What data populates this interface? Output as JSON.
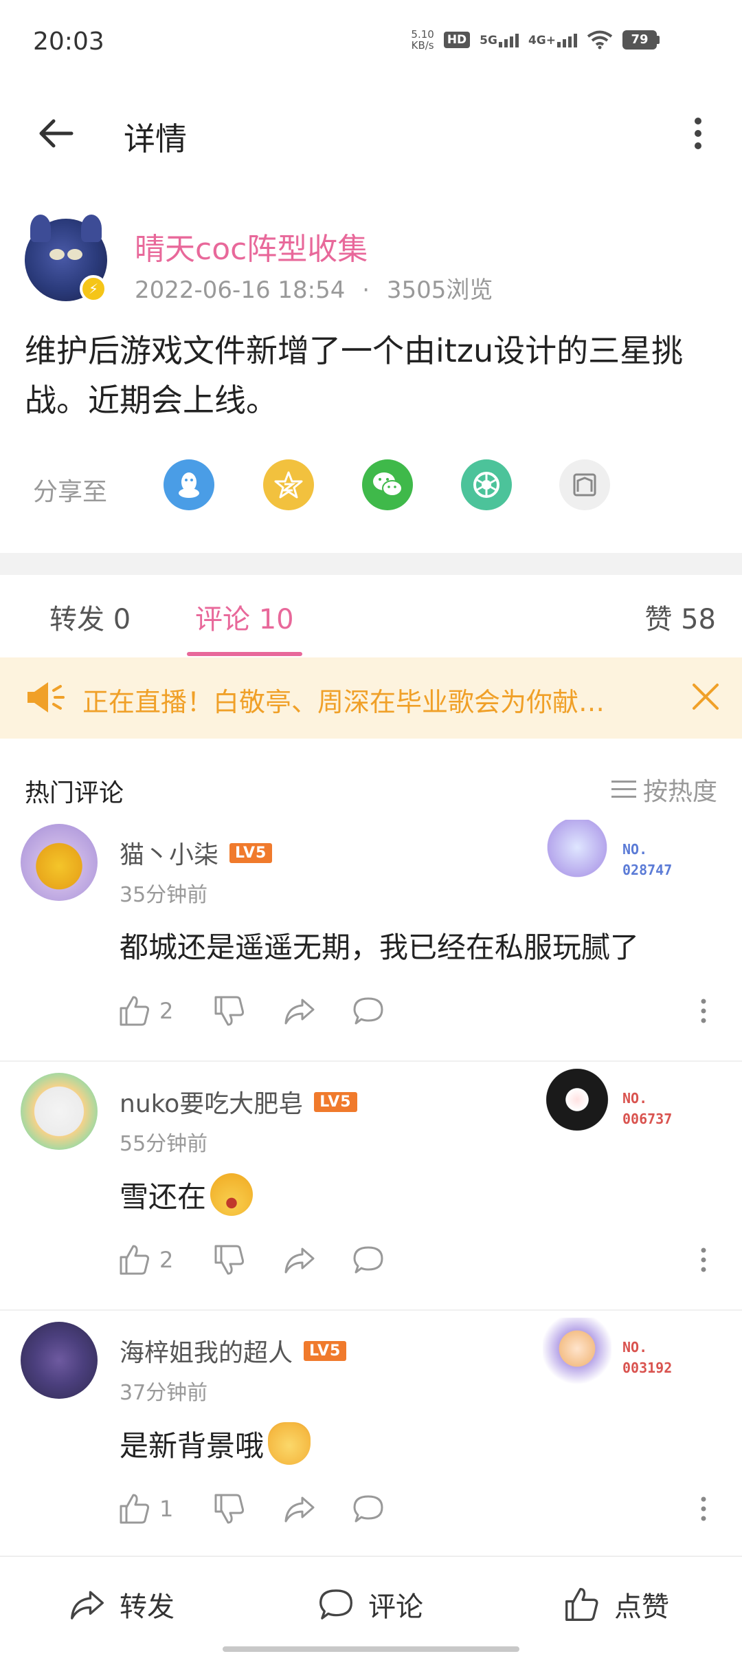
{
  "status_bar": {
    "time": "20:03",
    "net_speed_value": "5.10",
    "net_speed_unit": "KB/s",
    "hd_label": "HD",
    "signal_1": "5G",
    "signal_2": "4G+",
    "battery": "79"
  },
  "header": {
    "title": "详情"
  },
  "post": {
    "author": "晴天coc阵型收集",
    "date": "2022-06-16 18:54",
    "views": "3505浏览",
    "text": "维护后游戏文件新增了一个由itzu设计的三星挑战。近期会上线。",
    "share_label": "分享至",
    "share_targets": [
      "qq-icon",
      "qzone-icon",
      "wechat-icon",
      "moments-icon",
      "save-image-icon"
    ]
  },
  "tabs": {
    "repost": "转发 0",
    "comments": "评论 10",
    "likes": "赞 58"
  },
  "live_banner": {
    "text": "正在直播！白敬亭、周深在毕业歌会为你献…"
  },
  "hot_comments": {
    "title": "热门评论",
    "sort_label": "按热度"
  },
  "comments": [
    {
      "user": "猫丶小柒",
      "level": "LV5",
      "time": "35分钟前",
      "text": "都城还是遥遥无期，我已经在私服玩腻了",
      "likes": "2",
      "fan_no_label": "NO.",
      "fan_no_value": "028747"
    },
    {
      "user": "nuko要吃大肥皂",
      "level": "LV5",
      "time": "55分钟前",
      "text": "雪还在",
      "likes": "2",
      "fan_no_label": "NO.",
      "fan_no_value": "006737"
    },
    {
      "user": "海梓姐我的超人",
      "level": "LV5",
      "time": "37分钟前",
      "text": "是新背景哦",
      "likes": "1",
      "fan_no_label": "NO.",
      "fan_no_value": "003192"
    }
  ],
  "bottom_bar": {
    "repost": "转发",
    "comment": "评论",
    "like": "点赞"
  },
  "colors": {
    "accent": "#e8689a",
    "banner_text": "#f0a028",
    "level_badge": "#f07a2c"
  }
}
